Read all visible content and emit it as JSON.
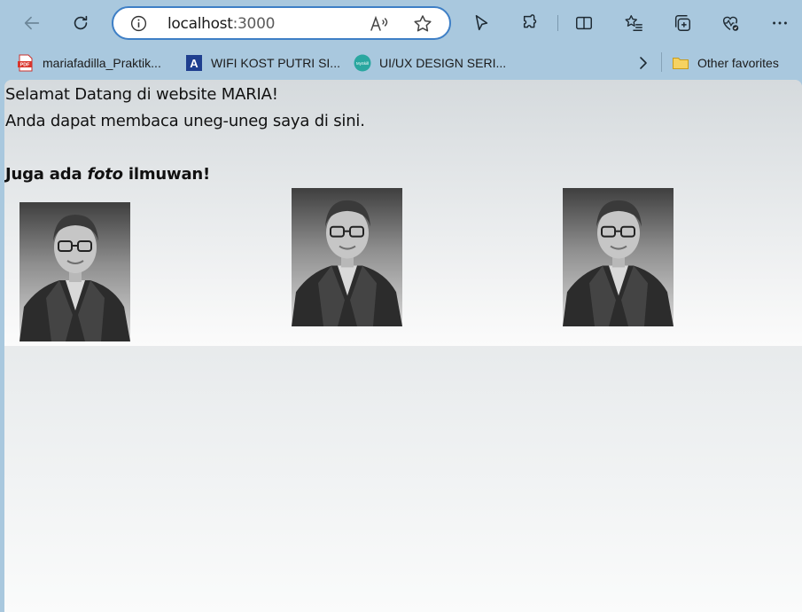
{
  "browser": {
    "url_host": "localhost",
    "url_port": ":3000",
    "icons": [
      "back-icon",
      "refresh-icon",
      "info-icon",
      "read-aloud-icon",
      "favorite-star-icon",
      "cursor-icon",
      "extensions-icon",
      "split-screen-icon",
      "favorites-icon",
      "collections-icon",
      "health-icon",
      "more-icon"
    ]
  },
  "bookmarks": {
    "items": [
      {
        "label": "mariafadilla_Praktik...",
        "icon": "pdf-icon"
      },
      {
        "label": "WIFI KOST PUTRI SI...",
        "icon": "a-letter-icon"
      },
      {
        "label": "UI/UX DESIGN SERI...",
        "icon": "myskill-icon"
      }
    ],
    "other": "Other favorites",
    "pdf_badge": "PDF",
    "a_badge": "A",
    "myskill_badge": "MySkill"
  },
  "page": {
    "line1": "Selamat Datang di website MARIA!",
    "line2": "Anda dapat membaca uneg-uneg saya di sini.",
    "heading_pre": "Juga ada ",
    "heading_em": "foto",
    "heading_post": " ilmuwan!",
    "photos_count": 3
  },
  "colors": {
    "chrome": "#a9c8de",
    "address_border": "#3e7fc6"
  }
}
